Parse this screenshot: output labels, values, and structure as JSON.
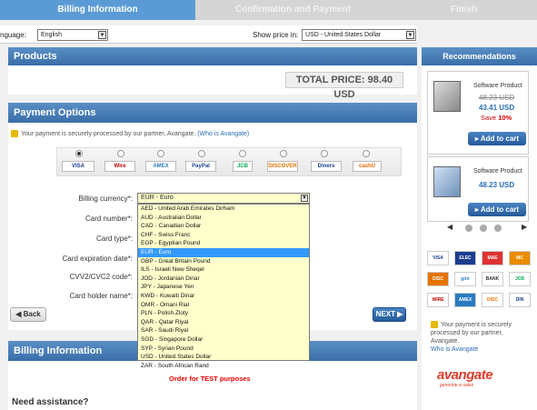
{
  "steps": [
    "Billing Information",
    "Confirmation and Payment",
    "Finish"
  ],
  "language": {
    "label": "nguage:",
    "value": "English"
  },
  "price_in": {
    "label": "Show price in:",
    "value": "USD - United States Dollar"
  },
  "products": {
    "title": "Products",
    "total": "TOTAL PRICE: 98.40 USD"
  },
  "payment": {
    "title": "Payment Options",
    "secure_text": "Your payment is securely processed by our partner, Avangate.",
    "secure_link": "(Who is Avangate)",
    "cards": [
      "VISA",
      "Wire",
      "AMEX",
      "PayPal",
      "JCB",
      "DISCOVER",
      "Diners",
      "cashU"
    ],
    "fields": {
      "billing_currency": "Billing currency*:",
      "card_number": "Card number*:",
      "card_type": "Card type*:",
      "expiration": "Card expiration date*:",
      "cvv": "CVV2/CVC2 code*:",
      "holder": "Card holder name*:"
    },
    "currency_selected": "EUR - Euro",
    "currency_options": [
      "AED - United Arab Emirates Dirham",
      "AUD - Australian Dollar",
      "CAD - Canadian Dollar",
      "CHF - Swiss Franc",
      "EGP - Egyptian Pound",
      "EUR - Euro",
      "GBP - Great Britain Pound",
      "ILS - Israeli New Sheqel",
      "JOD - Jordanian Dinar",
      "JPY - Japanese Yen",
      "KWD - Kuwaiti Dinar",
      "OMR - Omani Rial",
      "PLN - Polish Zloty",
      "QAR - Qatar Riyal",
      "SAR - Saudi Riyal",
      "SGD - Singapore Dollar",
      "SYP - Syrian Pound",
      "USD - United States Dollar",
      "ZAR - South African Rand"
    ],
    "back": "◀ Back",
    "next": "NEXT ▶"
  },
  "billing": {
    "title": "Billing Information",
    "test_note": "Order for TEST purposes"
  },
  "assist": "Need assistance?",
  "recommendations": {
    "title": "Recommendations",
    "items": [
      {
        "name": "Software Product",
        "old_price": "48.23 USD",
        "price": "43.41 USD",
        "save_label": "Save",
        "save_value": "10%",
        "button": "Add to cart"
      },
      {
        "name": "Software Product",
        "price": "48.23 USD",
        "button": "Add to cart"
      }
    ]
  },
  "right_secure": {
    "text": "Your payment is securely processed by our partner, Avangate.",
    "link": "Who is Avangate"
  },
  "brand": {
    "name": "avangate",
    "tagline": "generate e-sales"
  }
}
